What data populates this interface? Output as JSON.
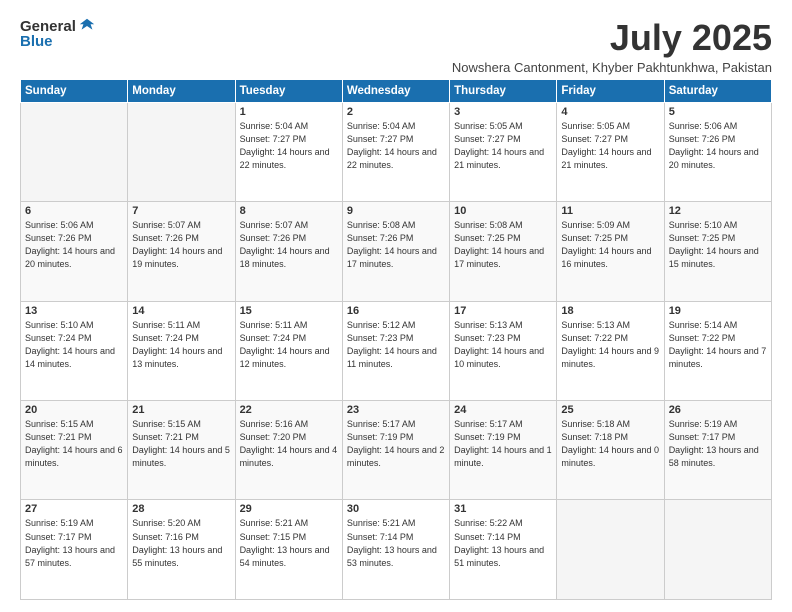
{
  "header": {
    "logo_line1": "General",
    "logo_line2": "Blue",
    "month_title": "July 2025",
    "location": "Nowshera Cantonment, Khyber Pakhtunkhwa, Pakistan"
  },
  "days_of_week": [
    "Sunday",
    "Monday",
    "Tuesday",
    "Wednesday",
    "Thursday",
    "Friday",
    "Saturday"
  ],
  "weeks": [
    [
      {
        "day": "",
        "info": ""
      },
      {
        "day": "",
        "info": ""
      },
      {
        "day": "1",
        "info": "Sunrise: 5:04 AM\nSunset: 7:27 PM\nDaylight: 14 hours and 22 minutes."
      },
      {
        "day": "2",
        "info": "Sunrise: 5:04 AM\nSunset: 7:27 PM\nDaylight: 14 hours and 22 minutes."
      },
      {
        "day": "3",
        "info": "Sunrise: 5:05 AM\nSunset: 7:27 PM\nDaylight: 14 hours and 21 minutes."
      },
      {
        "day": "4",
        "info": "Sunrise: 5:05 AM\nSunset: 7:27 PM\nDaylight: 14 hours and 21 minutes."
      },
      {
        "day": "5",
        "info": "Sunrise: 5:06 AM\nSunset: 7:26 PM\nDaylight: 14 hours and 20 minutes."
      }
    ],
    [
      {
        "day": "6",
        "info": "Sunrise: 5:06 AM\nSunset: 7:26 PM\nDaylight: 14 hours and 20 minutes."
      },
      {
        "day": "7",
        "info": "Sunrise: 5:07 AM\nSunset: 7:26 PM\nDaylight: 14 hours and 19 minutes."
      },
      {
        "day": "8",
        "info": "Sunrise: 5:07 AM\nSunset: 7:26 PM\nDaylight: 14 hours and 18 minutes."
      },
      {
        "day": "9",
        "info": "Sunrise: 5:08 AM\nSunset: 7:26 PM\nDaylight: 14 hours and 17 minutes."
      },
      {
        "day": "10",
        "info": "Sunrise: 5:08 AM\nSunset: 7:25 PM\nDaylight: 14 hours and 17 minutes."
      },
      {
        "day": "11",
        "info": "Sunrise: 5:09 AM\nSunset: 7:25 PM\nDaylight: 14 hours and 16 minutes."
      },
      {
        "day": "12",
        "info": "Sunrise: 5:10 AM\nSunset: 7:25 PM\nDaylight: 14 hours and 15 minutes."
      }
    ],
    [
      {
        "day": "13",
        "info": "Sunrise: 5:10 AM\nSunset: 7:24 PM\nDaylight: 14 hours and 14 minutes."
      },
      {
        "day": "14",
        "info": "Sunrise: 5:11 AM\nSunset: 7:24 PM\nDaylight: 14 hours and 13 minutes."
      },
      {
        "day": "15",
        "info": "Sunrise: 5:11 AM\nSunset: 7:24 PM\nDaylight: 14 hours and 12 minutes."
      },
      {
        "day": "16",
        "info": "Sunrise: 5:12 AM\nSunset: 7:23 PM\nDaylight: 14 hours and 11 minutes."
      },
      {
        "day": "17",
        "info": "Sunrise: 5:13 AM\nSunset: 7:23 PM\nDaylight: 14 hours and 10 minutes."
      },
      {
        "day": "18",
        "info": "Sunrise: 5:13 AM\nSunset: 7:22 PM\nDaylight: 14 hours and 9 minutes."
      },
      {
        "day": "19",
        "info": "Sunrise: 5:14 AM\nSunset: 7:22 PM\nDaylight: 14 hours and 7 minutes."
      }
    ],
    [
      {
        "day": "20",
        "info": "Sunrise: 5:15 AM\nSunset: 7:21 PM\nDaylight: 14 hours and 6 minutes."
      },
      {
        "day": "21",
        "info": "Sunrise: 5:15 AM\nSunset: 7:21 PM\nDaylight: 14 hours and 5 minutes."
      },
      {
        "day": "22",
        "info": "Sunrise: 5:16 AM\nSunset: 7:20 PM\nDaylight: 14 hours and 4 minutes."
      },
      {
        "day": "23",
        "info": "Sunrise: 5:17 AM\nSunset: 7:19 PM\nDaylight: 14 hours and 2 minutes."
      },
      {
        "day": "24",
        "info": "Sunrise: 5:17 AM\nSunset: 7:19 PM\nDaylight: 14 hours and 1 minute."
      },
      {
        "day": "25",
        "info": "Sunrise: 5:18 AM\nSunset: 7:18 PM\nDaylight: 14 hours and 0 minutes."
      },
      {
        "day": "26",
        "info": "Sunrise: 5:19 AM\nSunset: 7:17 PM\nDaylight: 13 hours and 58 minutes."
      }
    ],
    [
      {
        "day": "27",
        "info": "Sunrise: 5:19 AM\nSunset: 7:17 PM\nDaylight: 13 hours and 57 minutes."
      },
      {
        "day": "28",
        "info": "Sunrise: 5:20 AM\nSunset: 7:16 PM\nDaylight: 13 hours and 55 minutes."
      },
      {
        "day": "29",
        "info": "Sunrise: 5:21 AM\nSunset: 7:15 PM\nDaylight: 13 hours and 54 minutes."
      },
      {
        "day": "30",
        "info": "Sunrise: 5:21 AM\nSunset: 7:14 PM\nDaylight: 13 hours and 53 minutes."
      },
      {
        "day": "31",
        "info": "Sunrise: 5:22 AM\nSunset: 7:14 PM\nDaylight: 13 hours and 51 minutes."
      },
      {
        "day": "",
        "info": ""
      },
      {
        "day": "",
        "info": ""
      }
    ]
  ]
}
